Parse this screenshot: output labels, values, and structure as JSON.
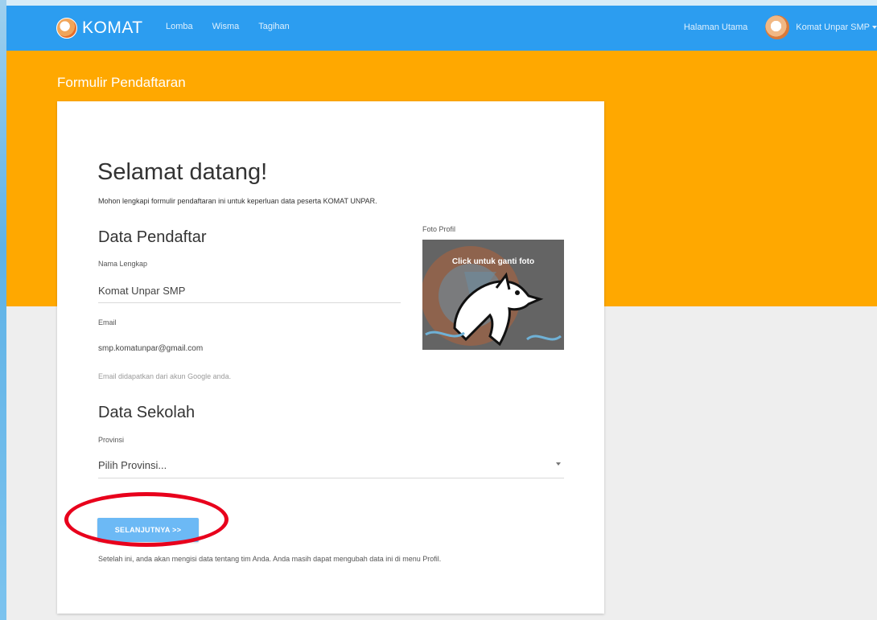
{
  "navbar": {
    "brand": "KOMAT",
    "links": [
      "Lomba",
      "Wisma",
      "Tagihan"
    ],
    "home": "Halaman Utama",
    "user": "Komat Unpar SMP"
  },
  "page": {
    "title": "Formulir Pendaftaran"
  },
  "form": {
    "welcome": "Selamat datang!",
    "intro": "Mohon lengkapi formulir pendaftaran ini untuk keperluan data peserta KOMAT UNPAR.",
    "registrant_section": "Data Pendaftar",
    "full_name_label": "Nama Lengkap",
    "full_name_value": "Komat Unpar SMP",
    "email_label": "Email",
    "email_value": "smp.komatunpar@gmail.com",
    "email_helper": "Email didapatkan dari akun Google anda.",
    "photo_label": "Foto Profil",
    "photo_overlay": "Click untuk ganti foto",
    "school_section": "Data Sekolah",
    "province_label": "Provinsi",
    "province_value": "Pilih Provinsi...",
    "next_button": "SELANJUTNYA >>",
    "footer_note": "Setelah ini, anda akan mengisi data tentang tim Anda. Anda masih dapat mengubah data ini di menu Profil."
  },
  "colors": {
    "navbar": "#2c9df0",
    "hero": "#ffa800",
    "button": "#6cb9f5",
    "annotation": "#e8001c"
  }
}
